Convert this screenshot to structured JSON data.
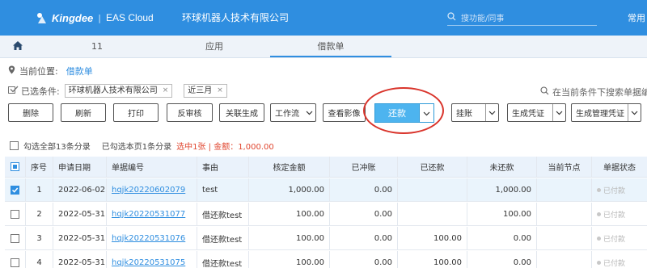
{
  "header": {
    "brand": "Kingdee",
    "product": "EAS Cloud",
    "company": "环球机器人技术有限公司",
    "search_placeholder": "搜功能/同事",
    "right_label": "常用"
  },
  "tabs": [
    {
      "label": "11"
    },
    {
      "label": "应用"
    },
    {
      "label": "借款单"
    }
  ],
  "location": {
    "label": "当前位置:",
    "value": "借款单"
  },
  "conditions": {
    "label": "已选条件:",
    "chips": [
      "环球机器人技术有限公司",
      "近三月"
    ]
  },
  "filter_search_placeholder": "在当前条件下搜索单据编",
  "toolbar": {
    "delete": "删除",
    "refresh": "刷新",
    "print": "打印",
    "unaudit": "反审核",
    "related": "关联生成",
    "workflow": "工作流",
    "view_image": "查看影像",
    "repay": "还款",
    "hang": "挂账",
    "gen_voucher": "生成凭证",
    "gen_mgmt_voucher": "生成管理凭证"
  },
  "selection": {
    "select_all": "勾选全部13条分录",
    "selected_page": "已勾选本页1条分录",
    "selected_summary": "选中1张 | 金额：1,000.00"
  },
  "table": {
    "columns": [
      "序号",
      "申请日期",
      "单据编号",
      "事由",
      "核定金额",
      "已冲账",
      "已还款",
      "未还款",
      "当前节点",
      "单据状态"
    ],
    "rows": [
      {
        "checked": true,
        "no": "1",
        "date": "2022-06-02",
        "code": "hqjk20220602079",
        "reason": "test",
        "approved": "1,000.00",
        "offset": "0.00",
        "repaid": "",
        "unpaid": "1,000.00",
        "node": "",
        "status": "已付款"
      },
      {
        "checked": false,
        "no": "2",
        "date": "2022-05-31",
        "code": "hqjk20220531077",
        "reason": "借还款test",
        "approved": "100.00",
        "offset": "0.00",
        "repaid": "",
        "unpaid": "100.00",
        "node": "",
        "status": "已付款"
      },
      {
        "checked": false,
        "no": "3",
        "date": "2022-05-31",
        "code": "hqjk20220531076",
        "reason": "借还款test",
        "approved": "100.00",
        "offset": "0.00",
        "repaid": "100.00",
        "unpaid": "0.00",
        "node": "",
        "status": "已付款"
      },
      {
        "checked": false,
        "no": "4",
        "date": "2022-05-31",
        "code": "hqjk20220531075",
        "reason": "借还款test",
        "approved": "100.00",
        "offset": "0.00",
        "repaid": "100.00",
        "unpaid": "0.00",
        "node": "",
        "status": "已付款"
      }
    ]
  },
  "colors": {
    "primary": "#2f8ee0",
    "repay_button": "#4db4ef",
    "highlight_circle": "#d9342b",
    "summary_text": "#e0462f"
  }
}
